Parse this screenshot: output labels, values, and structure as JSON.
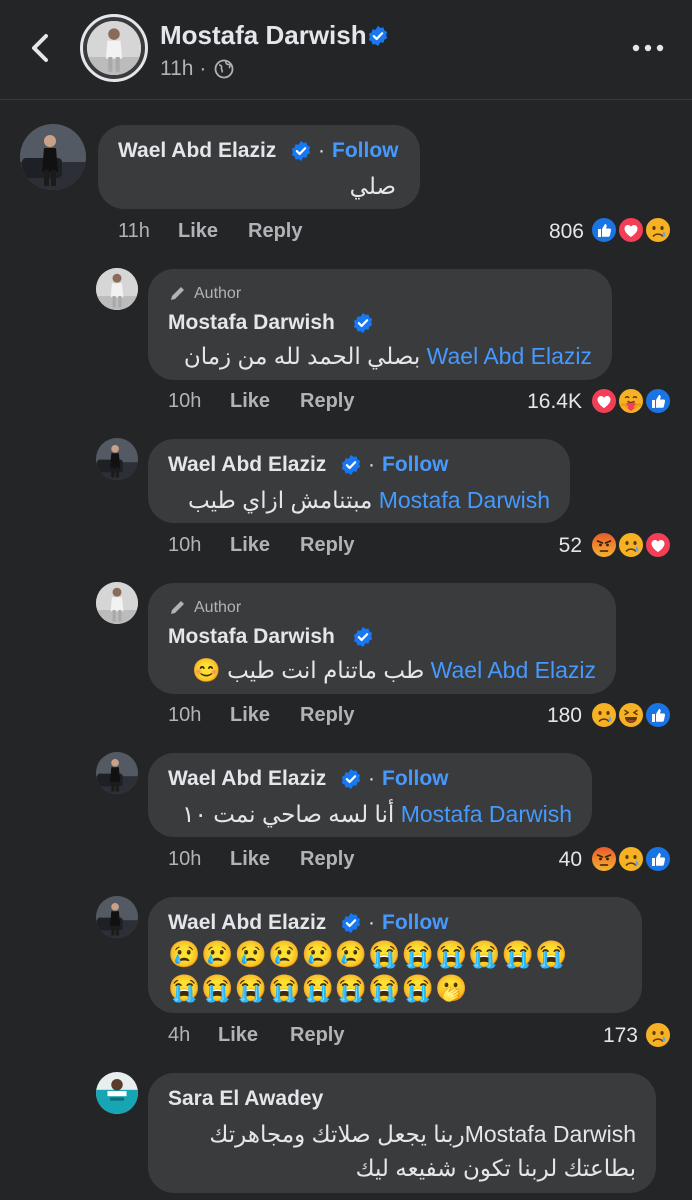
{
  "header": {
    "name": "Mostafa Darwish",
    "time": "11h",
    "separator": "·"
  },
  "colors": {
    "background": "#242526",
    "bubble": "#3a3b3c",
    "link": "#4599ff",
    "verified": "#1877f2"
  },
  "labels": {
    "like": "Like",
    "reply": "Reply",
    "follow": "Follow",
    "author": "Author",
    "dot": "·"
  },
  "comments": [
    {
      "name": "Wael Abd Elaziz",
      "text": "صلي",
      "time": "11h",
      "count": "806",
      "reactions": [
        "like",
        "love",
        "sad"
      ]
    },
    {
      "name": "Mostafa Darwish",
      "mention": "Wael Abd Elaziz",
      "text": "بصلي الحمد لله من زمان",
      "time": "10h",
      "count": "16.4K",
      "reactions": [
        "love",
        "care",
        "like"
      ]
    },
    {
      "name": "Wael Abd Elaziz",
      "mention": "Mostafa Darwish",
      "text": "مبتنامش ازاي طيب",
      "time": "10h",
      "count": "52",
      "reactions": [
        "angry",
        "sad",
        "love"
      ]
    },
    {
      "name": "Mostafa Darwish",
      "mention": "Wael Abd Elaziz",
      "text": "طب ماتنام انت طيب",
      "emoji": "😊",
      "time": "10h",
      "count": "180",
      "reactions": [
        "sad",
        "haha",
        "like"
      ]
    },
    {
      "name": "Wael Abd Elaziz",
      "mention": "Mostafa Darwish",
      "text": "أنا لسه صاحي نمت ١٠",
      "time": "10h",
      "count": "40",
      "reactions": [
        "angry",
        "sad",
        "like"
      ]
    },
    {
      "name": "Wael Abd Elaziz",
      "emoji_line1": "😢😢😢😢😢😢😭😭😭😭😭😭",
      "emoji_line2": "😭😭😭😭😭😭😭😭🫢",
      "time": "4h",
      "count": "173",
      "reactions": [
        "sad"
      ]
    },
    {
      "name": "Sara El Awadey",
      "line1": "ربنا  يجعل صلاتك ومجاهرتكMostafa Darwish",
      "line2": "بطاعتك لربنا تكون شفيعه ليك"
    }
  ]
}
